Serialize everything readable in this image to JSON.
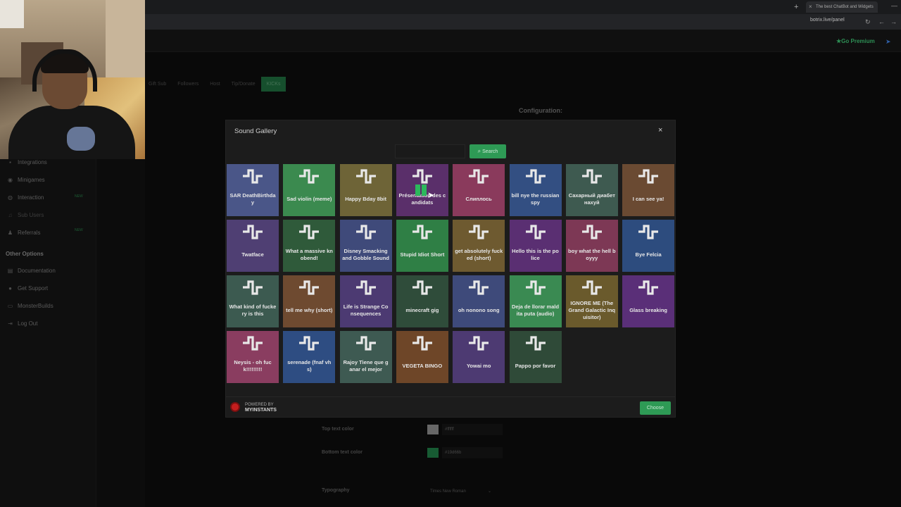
{
  "browser": {
    "tab_title": "The best ChatBot and Widgets",
    "new_tab": "+",
    "tab_close": "×",
    "url": "botrix.live/panel",
    "nav": {
      "refresh": "↻",
      "back": "←",
      "forward": "→"
    },
    "window": {
      "minimize": "—"
    }
  },
  "header": {
    "premium_label": "Go Premium"
  },
  "sidebar": {
    "items": [
      {
        "label": "Integrations",
        "icon": "puzzle-icon"
      },
      {
        "label": "Minigames",
        "icon": "gamepad-icon"
      },
      {
        "label": "Interaction",
        "icon": "chat-icon",
        "badge": "NEW"
      },
      {
        "label": "Sub Users",
        "icon": "music-icon"
      },
      {
        "label": "Referrals",
        "icon": "users-icon",
        "badge": "NEW"
      }
    ],
    "other_heading": "Other Options",
    "other_items": [
      {
        "label": "Documentation",
        "icon": "book-icon"
      },
      {
        "label": "Get Support",
        "icon": "help-icon"
      },
      {
        "label": "MonsterBuilds",
        "icon": "monitor-icon"
      },
      {
        "label": "Log Out",
        "icon": "logout-icon"
      }
    ]
  },
  "tabs": [
    {
      "label": "Gift Sub",
      "active": false
    },
    {
      "label": "Followers",
      "active": false
    },
    {
      "label": "Host",
      "active": false
    },
    {
      "label": "Tip/Donate",
      "active": false
    },
    {
      "label": "KICKs",
      "active": true
    }
  ],
  "config": {
    "title": "Configuration:",
    "top_text_color_label": "Top text color",
    "top_text_color_value": "#ffffff",
    "bottom_text_color_label": "Bottom text color",
    "bottom_text_color_value": "#19d66b",
    "typography_label": "Typography",
    "typography_value": "Times New Roman"
  },
  "modal": {
    "title": "Sound Gallery",
    "close": "×",
    "search_placeholder": "",
    "search_label": "Search",
    "powered_by": "POWERED BY",
    "brand": "MYINSTANTS",
    "choose_label": "Choose",
    "sounds": [
      {
        "label": "SAR DeathBirthday",
        "color": "#4a5688"
      },
      {
        "label": "Sad violin (meme)",
        "color": "#3b8a4f"
      },
      {
        "label": "Happy Bday 8bit",
        "color": "#6e6437"
      },
      {
        "label": "Présentation des candidats",
        "color": "#5a2f6a"
      },
      {
        "label": "Слиплось",
        "color": "#8a3a5c"
      },
      {
        "label": "bill nye the russian spy",
        "color": "#334f82"
      },
      {
        "label": "Сахарный диабет нахуй",
        "color": "#3e5a50"
      },
      {
        "label": "I can see ya!",
        "color": "#6a4a32"
      },
      {
        "label": "Twatface",
        "color": "#4f3f73"
      },
      {
        "label": "What a massive knobend!",
        "color": "#2f5a3a"
      },
      {
        "label": "Disney Smacking and Gobble Sound",
        "color": "#3f4a7a"
      },
      {
        "label": "Stupid Idiot Short",
        "color": "#2f7f45"
      },
      {
        "label": "get absolutely fucked (short)",
        "color": "#6e5a30"
      },
      {
        "label": "Hello this is the police",
        "color": "#5a2f72"
      },
      {
        "label": "boy what the hell boyyy",
        "color": "#7d3855"
      },
      {
        "label": "Bye Felcia",
        "color": "#2d4c7e"
      },
      {
        "label": "What kind of fuckery is this",
        "color": "#3c5a50"
      },
      {
        "label": "tell me why (short)",
        "color": "#6e4a30"
      },
      {
        "label": "Life is Strange Consequences",
        "color": "#4c3a72"
      },
      {
        "label": "minecraft gig",
        "color": "#2f4c3a"
      },
      {
        "label": "oh nonono song",
        "color": "#3e4a7a"
      },
      {
        "label": "Deja de llorar maldita puta (audio)",
        "color": "#3a8a52"
      },
      {
        "label": "IGNORE ME (The Grand Galactic Inquisitor)",
        "color": "#6a5a2c"
      },
      {
        "label": "Glass breaking",
        "color": "#5a2f78"
      },
      {
        "label": "Neysis - oh fuck!!!!!!!!!",
        "color": "#8a3d60"
      },
      {
        "label": "serenade (fnaf vhs)",
        "color": "#2e4d82"
      },
      {
        "label": "Rajoy Tiene que ganar el mejor",
        "color": "#3e5a52"
      },
      {
        "label": "VEGETA BINGO",
        "color": "#6e4628"
      },
      {
        "label": "Yowai mo",
        "color": "#4d3a72"
      },
      {
        "label": "Pappo por favor",
        "color": "#2f4a38"
      }
    ]
  }
}
